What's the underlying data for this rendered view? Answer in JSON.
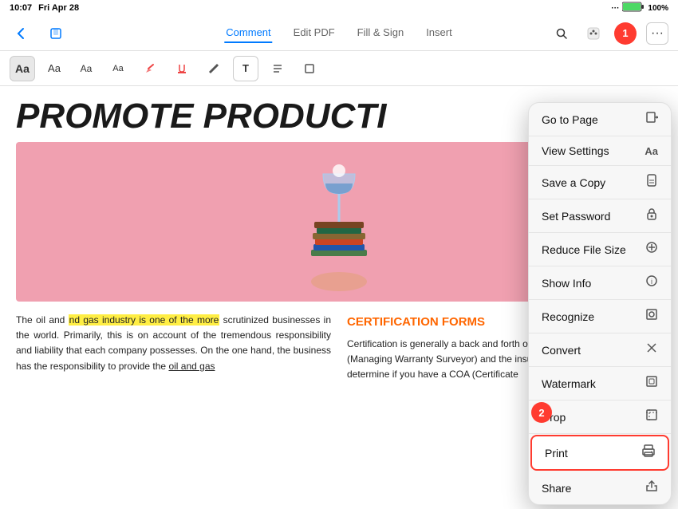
{
  "statusBar": {
    "time": "10:07",
    "day": "Fri Apr 28",
    "dots": "···",
    "battery": "100%"
  },
  "navBar": {
    "tabs": [
      "Comment",
      "Edit PDF",
      "Fill & Sign",
      "Insert"
    ],
    "activeTab": "Comment"
  },
  "toolbar": {
    "buttons": [
      "Aa",
      "Aa",
      "Aa",
      "Aa",
      "✏️",
      "🖊️",
      "✏️",
      "T",
      "≡",
      "□"
    ]
  },
  "header": {
    "text": "PROMOTE PRODUCTI"
  },
  "textLeft": "The oil and gas industry is one of the more scrutinized businesses in the world. Primarily, this is on account of the tremendous responsibility and liability that each company possesses. On the one hand, the business has the responsibility to provide the oil and gas",
  "textLeftHighlight": "nd gas industry is one of the more",
  "textRight": {
    "title": "CERTIFICATION FORMS",
    "body": "Certification is generally a back and forth of fixes between the MWS (Managing Warranty Surveyor) and the insurer. Since the MWS will determine if you have a COA (Certificate"
  },
  "menu": {
    "items": [
      {
        "label": "Go to Page",
        "icon": "📄"
      },
      {
        "label": "View Settings",
        "icon": "Aa"
      },
      {
        "label": "Save a Copy",
        "icon": "🔖"
      },
      {
        "label": "Set Password",
        "icon": "🔒"
      },
      {
        "label": "Reduce File Size",
        "icon": "⊕"
      },
      {
        "label": "Show Info",
        "icon": "ℹ️"
      },
      {
        "label": "Recognize",
        "icon": "📷"
      },
      {
        "label": "Convert",
        "icon": "✂️"
      },
      {
        "label": "Watermark",
        "icon": "🔲"
      },
      {
        "label": "Crop",
        "icon": "📐"
      },
      {
        "label": "Print",
        "icon": "🖨️",
        "highlighted": true
      },
      {
        "label": "Share",
        "icon": "⬆️"
      }
    ]
  },
  "badges": {
    "badge1Label": "1",
    "badge2Label": "2"
  }
}
